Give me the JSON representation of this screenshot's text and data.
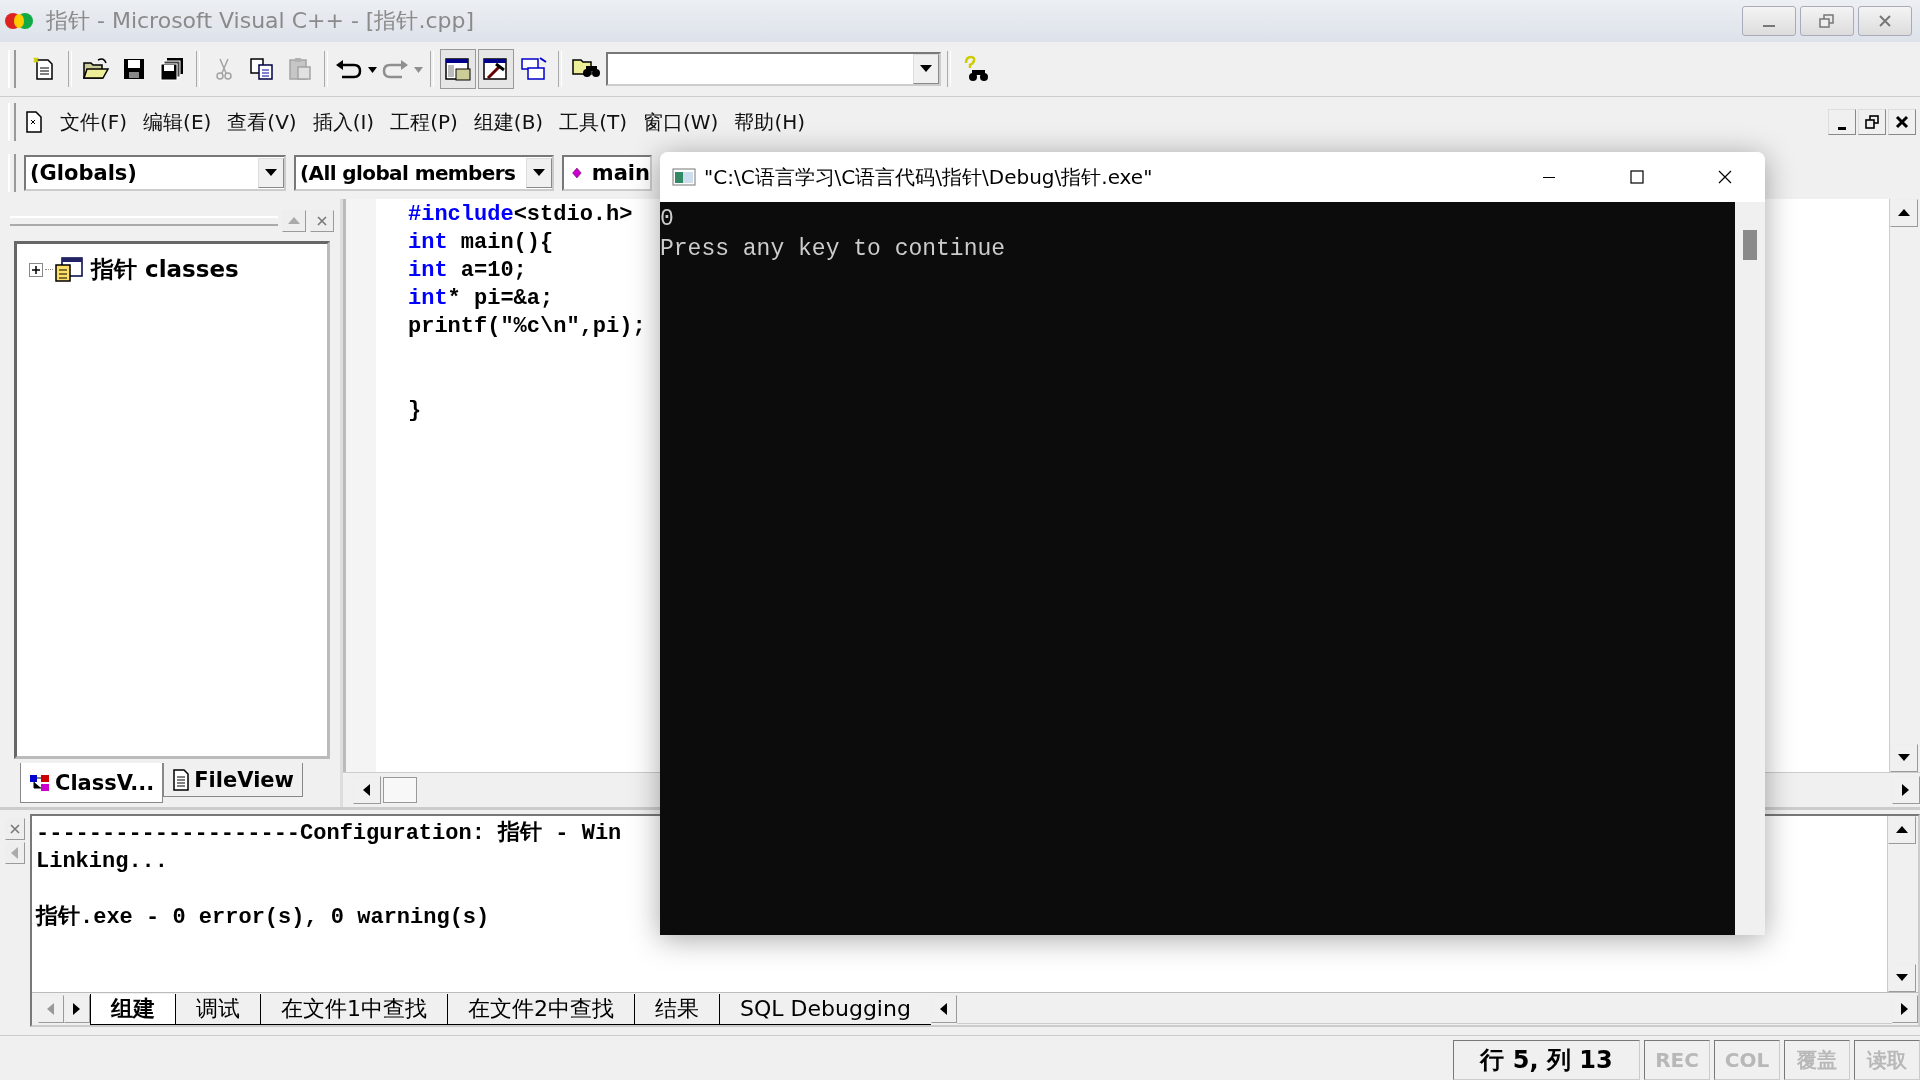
{
  "window": {
    "title": "指针 - Microsoft Visual C++ - [指针.cpp]",
    "active": false
  },
  "toolbar": [
    {
      "kind": "new",
      "disabled": false
    },
    {
      "kind": "open",
      "disabled": false
    },
    {
      "kind": "save",
      "disabled": false
    },
    {
      "kind": "save-all",
      "disabled": false
    },
    {
      "kind": "cut",
      "disabled": true
    },
    {
      "kind": "copy",
      "disabled": false
    },
    {
      "kind": "paste",
      "disabled": true
    },
    {
      "kind": "undo",
      "disabled": false
    },
    {
      "kind": "redo",
      "disabled": true
    },
    {
      "kind": "workspace",
      "disabled": false
    },
    {
      "kind": "output",
      "disabled": false
    },
    {
      "kind": "windows",
      "disabled": false
    },
    {
      "kind": "find-in-files",
      "disabled": false
    },
    {
      "kind": "combo",
      "disabled": false
    },
    {
      "kind": "find",
      "disabled": false
    }
  ],
  "menu": [
    "文件(F)",
    "编辑(E)",
    "查看(V)",
    "插入(I)",
    "工程(P)",
    "组建(B)",
    "工具(T)",
    "窗口(W)",
    "帮助(H)"
  ],
  "wizard_bar": {
    "class": "(Globals)",
    "filter": "(All global members",
    "member": "main"
  },
  "workspace": {
    "tree": [
      {
        "label": "指针 classes",
        "expanded": false
      }
    ],
    "tabs": [
      {
        "label": "ClassV...",
        "kind": "classview",
        "selected": true
      },
      {
        "label": "FileView",
        "kind": "fileview",
        "selected": false
      }
    ]
  },
  "editor": {
    "lines": [
      {
        "kind": "code",
        "tokens": [
          {
            "text": "#include",
            "kind": "keyword"
          },
          {
            "text": "<stdio.h>",
            "kind": "plain"
          }
        ]
      },
      {
        "kind": "code",
        "tokens": [
          {
            "text": "int",
            "kind": "keyword"
          },
          {
            "text": " main(){",
            "kind": "plain"
          }
        ]
      },
      {
        "kind": "code",
        "tokens": [
          {
            "text": "int",
            "kind": "keyword"
          },
          {
            "text": " a=10;",
            "kind": "plain"
          }
        ]
      },
      {
        "kind": "code",
        "tokens": [
          {
            "text": "int",
            "kind": "keyword"
          },
          {
            "text": "* pi=&a;",
            "kind": "plain"
          }
        ]
      },
      {
        "kind": "code",
        "tokens": [
          {
            "text": "printf(\"%c\\n\",pi);",
            "kind": "plain"
          }
        ]
      },
      {
        "kind": "blank"
      },
      {
        "kind": "blank"
      },
      {
        "kind": "code",
        "tokens": [
          {
            "text": "}",
            "kind": "plain"
          }
        ]
      }
    ]
  },
  "output": {
    "lines": [
      {
        "kind": "text",
        "text": "--------------------Configuration: 指针 - Win"
      },
      {
        "kind": "text",
        "text": "Linking..."
      },
      {
        "kind": "blank"
      },
      {
        "kind": "text",
        "text": "指针.exe - 0 error(s), 0 warning(s)"
      }
    ],
    "tabs": [
      {
        "label": "组建",
        "selected": true
      },
      {
        "label": "调试",
        "selected": false
      },
      {
        "label": "在文件1中查找",
        "selected": false
      },
      {
        "label": "在文件2中查找",
        "selected": false
      },
      {
        "label": "结果",
        "selected": false
      },
      {
        "label": "SQL Debugging",
        "selected": false
      }
    ]
  },
  "status_bar": {
    "position": "行 5, 列 13",
    "indicators": [
      {
        "label": "REC",
        "enabled": false
      },
      {
        "label": "COL",
        "enabled": false
      },
      {
        "label": "覆盖",
        "enabled": false
      },
      {
        "label": "读取",
        "enabled": false
      }
    ]
  },
  "console": {
    "title": "\"C:\\C语言学习\\C语言代码\\指针\\Debug\\指针.exe\"",
    "lines": [
      "0",
      "Press any key to continue"
    ]
  }
}
